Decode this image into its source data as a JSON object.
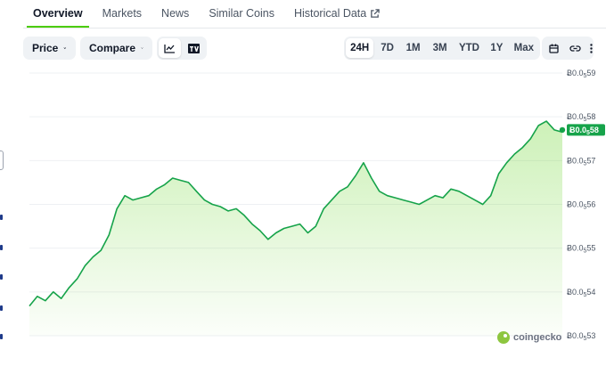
{
  "tabs": [
    {
      "label": "Overview",
      "active": true
    },
    {
      "label": "Markets",
      "active": false
    },
    {
      "label": "News",
      "active": false
    },
    {
      "label": "Similar Coins",
      "active": false
    },
    {
      "label": "Historical Data",
      "active": false,
      "icon": "external-link-icon"
    }
  ],
  "toolbar": {
    "price_label": "Price",
    "compare_label": "Compare",
    "chart_style_icons": [
      "line-chart-icon",
      "tradingview-icon"
    ],
    "ranges": [
      "24H",
      "7D",
      "1M",
      "3M",
      "YTD",
      "1Y",
      "Max"
    ],
    "active_range": "24H",
    "right_icons": [
      "calendar-icon",
      "link-icon",
      "more-icon"
    ]
  },
  "colors": {
    "line": "#16a34a",
    "fill_top": "#4bcc00",
    "badge": "#16a34a",
    "active_tab_underline": "#4bcc00"
  },
  "watermark": "coingecko",
  "chart_data": {
    "type": "area",
    "currency_symbol": "Ƀ",
    "y_tick_labels": [
      {
        "prefix": "Ƀ0.0",
        "sub": "5",
        "digits": "59"
      },
      {
        "prefix": "Ƀ0.0",
        "sub": "5",
        "digits": "58"
      },
      {
        "prefix": "Ƀ0.0",
        "sub": "5",
        "digits": "57"
      },
      {
        "prefix": "Ƀ0.0",
        "sub": "5",
        "digits": "56"
      },
      {
        "prefix": "Ƀ0.0",
        "sub": "5",
        "digits": "55"
      },
      {
        "prefix": "Ƀ0.0",
        "sub": "5",
        "digits": "54"
      },
      {
        "prefix": "Ƀ0.0",
        "sub": "5",
        "digits": "53"
      }
    ],
    "y_ticks": [
      59,
      58,
      57,
      56,
      55,
      54,
      53
    ],
    "ylim": [
      53,
      59
    ],
    "y_unit_note": "values in units of 1e-7 BTC",
    "last_value": 57.7,
    "last_label": {
      "prefix": "Ƀ0.0",
      "sub": "5",
      "digits": "58"
    },
    "series": [
      {
        "values": [
          53.68,
          53.9,
          53.8,
          54.0,
          53.85,
          54.1,
          54.3,
          54.6,
          54.8,
          54.95,
          55.3,
          55.9,
          56.2,
          56.1,
          56.15,
          56.2,
          56.35,
          56.45,
          56.6,
          56.55,
          56.5,
          56.3,
          56.1,
          56.0,
          55.95,
          55.85,
          55.9,
          55.75,
          55.55,
          55.4,
          55.2,
          55.35,
          55.45,
          55.5,
          55.55,
          55.35,
          55.5,
          55.9,
          56.1,
          56.3,
          56.4,
          56.65,
          56.95,
          56.6,
          56.3,
          56.2,
          56.15,
          56.1,
          56.05,
          56.0,
          56.1,
          56.2,
          56.15,
          56.35,
          56.3,
          56.2,
          56.1,
          56.0,
          56.2,
          56.7,
          56.95,
          57.15,
          57.3,
          57.5,
          57.8,
          57.9,
          57.7,
          57.65
        ]
      }
    ]
  }
}
